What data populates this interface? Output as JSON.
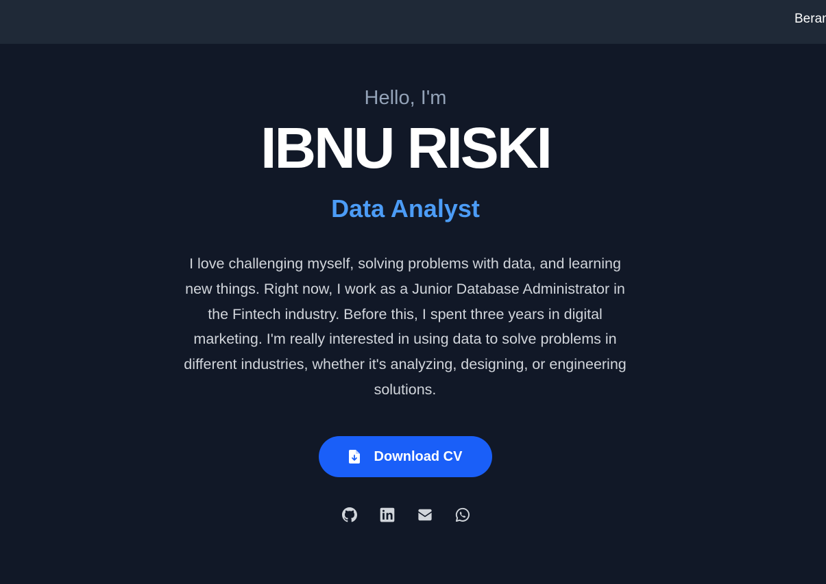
{
  "navbar": {
    "link_label": "Beranda"
  },
  "hero": {
    "greeting": "Hello, I'm",
    "name": "IBNU RISKI",
    "role": "Data Analyst",
    "bio": "I love challenging myself, solving problems with data, and learning new things. Right now, I work as a Junior Database Administrator in the Fintech industry. Before this, I spent three years in digital marketing. I'm really interested in using data to solve problems in different industries, whether it's analyzing, designing, or engineering solutions.",
    "cv_button_label": "Download CV",
    "cv_button_icon": "file-download-icon"
  },
  "socials": [
    {
      "icon": "github-icon"
    },
    {
      "icon": "linkedin-icon"
    },
    {
      "icon": "email-icon"
    },
    {
      "icon": "whatsapp-icon"
    }
  ],
  "colors": {
    "page_bg": "#111827",
    "navbar_bg": "#1f2937",
    "accent": "#4c9cf6",
    "button_bg": "#1a5ff8"
  }
}
